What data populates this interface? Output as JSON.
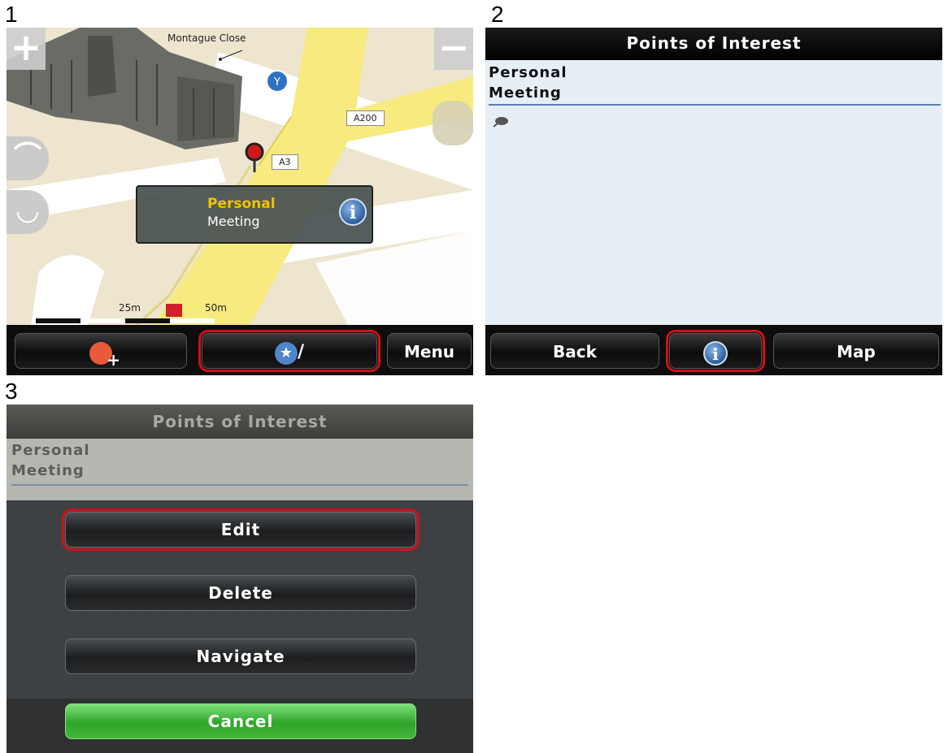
{
  "steps": [
    "1",
    "2",
    "3"
  ],
  "map_screen": {
    "zoom_in": "+",
    "zoom_out": "−",
    "street_label": "Montague Close",
    "road_a200": "A200",
    "road_a3": "A3",
    "popup": {
      "category": "Personal",
      "name": "Meeting",
      "icon": "info-icon"
    },
    "scale": {
      "label_25": "25m",
      "label_50": "50m"
    },
    "bottom_bar": {
      "add_poi_icon": "add-poi-icon",
      "favorites_icon": "star-slash-icon",
      "menu_label": "Menu"
    }
  },
  "poi_list_screen": {
    "title": "Points of Interest",
    "category": "Personal",
    "name": "Meeting",
    "item_icon": "pin-icon",
    "bottom_bar": {
      "back_label": "Back",
      "info_icon": "info-icon",
      "map_label": "Map"
    }
  },
  "dialog_screen": {
    "title": "Points of Interest",
    "category": "Personal",
    "name": "Meeting",
    "buttons": {
      "edit": "Edit",
      "delete": "Delete",
      "navigate": "Navigate",
      "cancel": "Cancel"
    }
  },
  "colors": {
    "highlight": "#d0101a",
    "popup_category": "#f1c400",
    "cancel_green": "#3cb535"
  }
}
